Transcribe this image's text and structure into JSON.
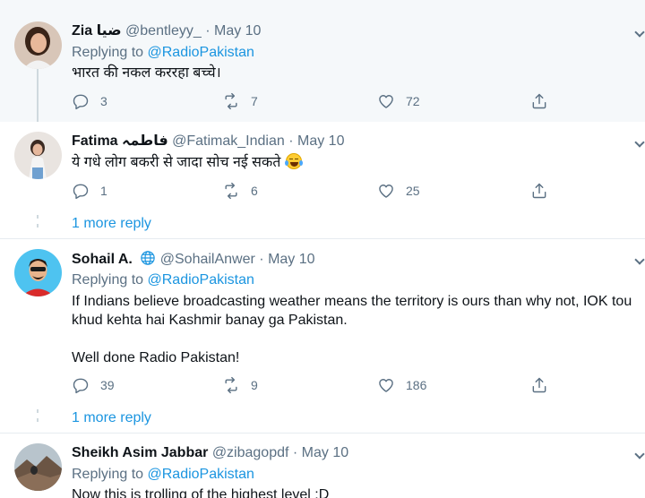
{
  "tweets": [
    {
      "name": "Zia",
      "name_suffix": "ضیا",
      "handle": "@bentleyy_",
      "date": "May 10",
      "replying_prefix": "Replying to ",
      "replying_handle": "@RadioPakistan",
      "text": "भारत की नकल कररहा बच्चे।",
      "replies": "3",
      "retweets": "7",
      "likes": "72"
    },
    {
      "name": "Fatima",
      "name_suffix": "فاطمہ",
      "handle": "@Fatimak_Indian",
      "date": "May 10",
      "text": "ये गधे लोग बकरी से जादा सोच नई सकते",
      "emoji": "face-with-tears-of-joy",
      "replies": "1",
      "retweets": "6",
      "likes": "25",
      "more_reply": "1 more reply"
    },
    {
      "name": "Sohail A.",
      "handle": "@SohailAnwer",
      "date": "May 10",
      "replying_prefix": "Replying to ",
      "replying_handle": "@RadioPakistan",
      "text_line1": "If Indians believe broadcasting weather means the territory is ours than why not, IOK tou",
      "text_line2": "khud kehta hai Kashmir banay ga Pakistan.",
      "text_line3": "Well done Radio Pakistan!",
      "replies": "39",
      "retweets": "9",
      "likes": "186",
      "more_reply": "1 more reply"
    },
    {
      "name": "Sheikh Asim Jabbar",
      "handle": "@zibagopdf",
      "date": "May 10",
      "replying_prefix": "Replying to ",
      "replying_handle": "@RadioPakistan",
      "text": "Now this is trolling of the highest level :D"
    }
  ],
  "separator": " · ",
  "colors": {
    "link": "#1b95e0",
    "muted": "#5b7083",
    "highlight_bg": "#f5f8fa",
    "divider": "#e6ecf0"
  },
  "icons": [
    "reply-icon",
    "retweet-icon",
    "like-icon",
    "share-icon",
    "globe-icon",
    "more-chevron-icon"
  ]
}
